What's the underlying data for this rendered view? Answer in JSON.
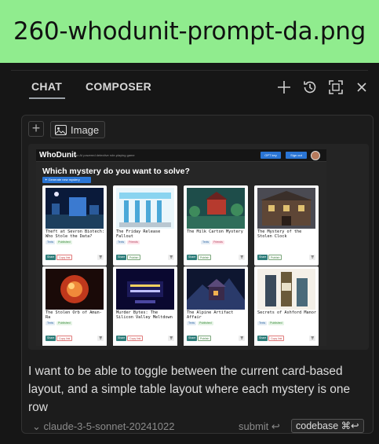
{
  "banner": {
    "filename": "260-whodunit-prompt-da.png"
  },
  "tabs": {
    "chat": "CHAT",
    "composer": "COMPOSER"
  },
  "toolbar": {
    "icons": [
      "plus-icon",
      "history-icon",
      "expand-icon",
      "close-icon"
    ]
  },
  "attach": {
    "plus": "+",
    "image_label": "Image"
  },
  "screenshot": {
    "app_name": "WhoDunit",
    "tagline": "an AI powered detective role-playing game",
    "key_button": "OPT key",
    "signout_button": "Sign out",
    "heading": "Which mystery do you want to solve?",
    "search_button": "✦ Generate new mystery",
    "cards": [
      {
        "title": "Theft at Sevron Biotech: Who Stole the Data?",
        "tags": [
          "Texts",
          "Published"
        ],
        "send": "Copy link"
      },
      {
        "title": "The Friday Release Fallout",
        "tags": [
          "Texts",
          "Friends"
        ],
        "send": "Publish"
      },
      {
        "title": "The Milk Carton Mystery",
        "tags": [
          "Texts",
          "Friends"
        ],
        "send": "Publish"
      },
      {
        "title": "The Mystery of the Stolen Clock",
        "tags": [],
        "send": "Publish"
      },
      {
        "title": "The Stolen Orb of Amun-Ra",
        "tags": [
          "Texts",
          "Published"
        ],
        "send": "Copy link"
      },
      {
        "title": "Murder Bytes: The Silicon Valley Meltdown",
        "tags": [],
        "send": "Copy link"
      },
      {
        "title": "The Alpine Artifact Affair",
        "tags": [
          "Texts",
          "Published"
        ],
        "send": "Publish"
      },
      {
        "title": "Secrets of Ashford Manor",
        "tags": [
          "Texts",
          "Published"
        ],
        "send": "Copy link"
      }
    ],
    "share_label": "Share",
    "delete_label": "🗑"
  },
  "message": "I want to be able to toggle between the current card-based layout, and a simple table layout where each mystery is one row",
  "footer": {
    "model": "claude-3-5-sonnet-20241022",
    "submit": "submit ↩",
    "codebase": "codebase ⌘↩"
  }
}
